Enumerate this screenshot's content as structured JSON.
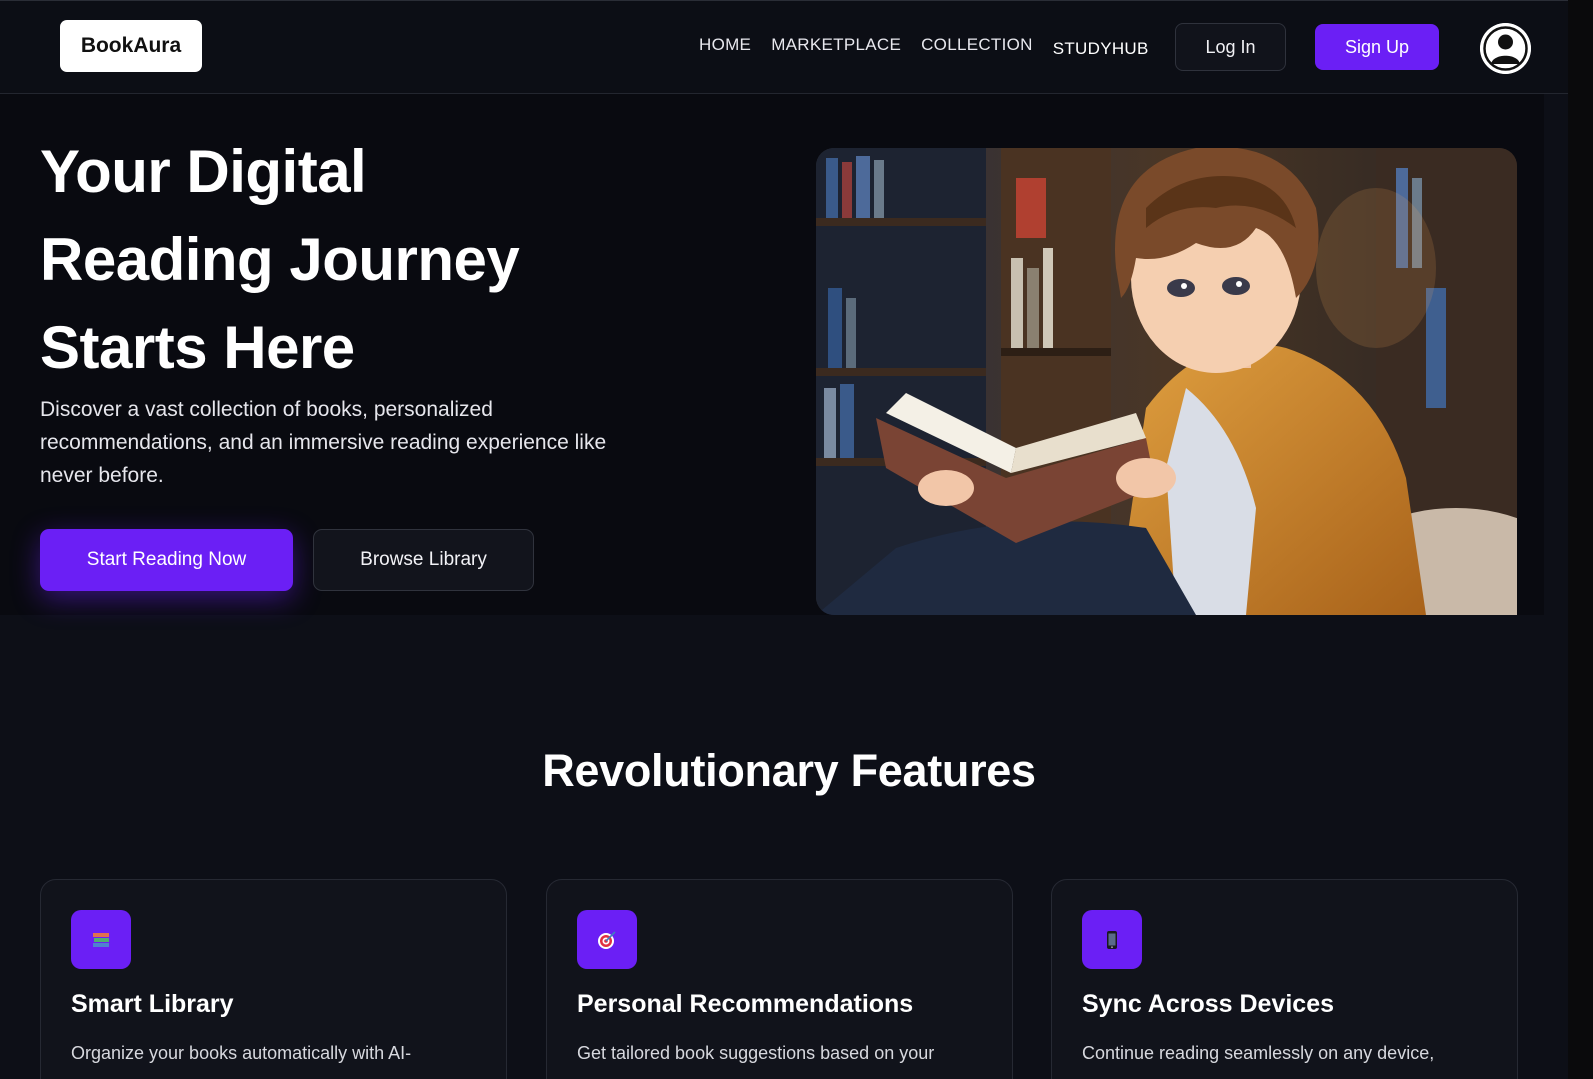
{
  "brand": {
    "logo_text": "BookAura"
  },
  "nav": {
    "links": [
      "HOME",
      "MARKETPLACE",
      "COLLECTION",
      "STUDYHUB"
    ],
    "login_label": "Log In",
    "signup_label": "Sign Up"
  },
  "hero": {
    "title_lines": [
      "Your Digital",
      "Reading Journey",
      "Starts Here"
    ],
    "description": "Discover a vast collection of books, personalized recommendations, and an immersive reading experience like never before.",
    "primary_cta": "Start Reading Now",
    "secondary_cta": "Browse Library"
  },
  "features": {
    "title": "Revolutionary Features",
    "cards": [
      {
        "icon": "books-icon",
        "title": "Smart Library",
        "desc": "Organize your books automatically with AI-"
      },
      {
        "icon": "target-icon",
        "title": "Personal Recommendations",
        "desc": "Get tailored book suggestions based on your"
      },
      {
        "icon": "phone-icon",
        "title": "Sync Across Devices",
        "desc": "Continue reading seamlessly on any device,"
      }
    ]
  },
  "colors": {
    "accent": "#6b1ff5",
    "background": "#0d0f17",
    "card": "#11131b"
  }
}
